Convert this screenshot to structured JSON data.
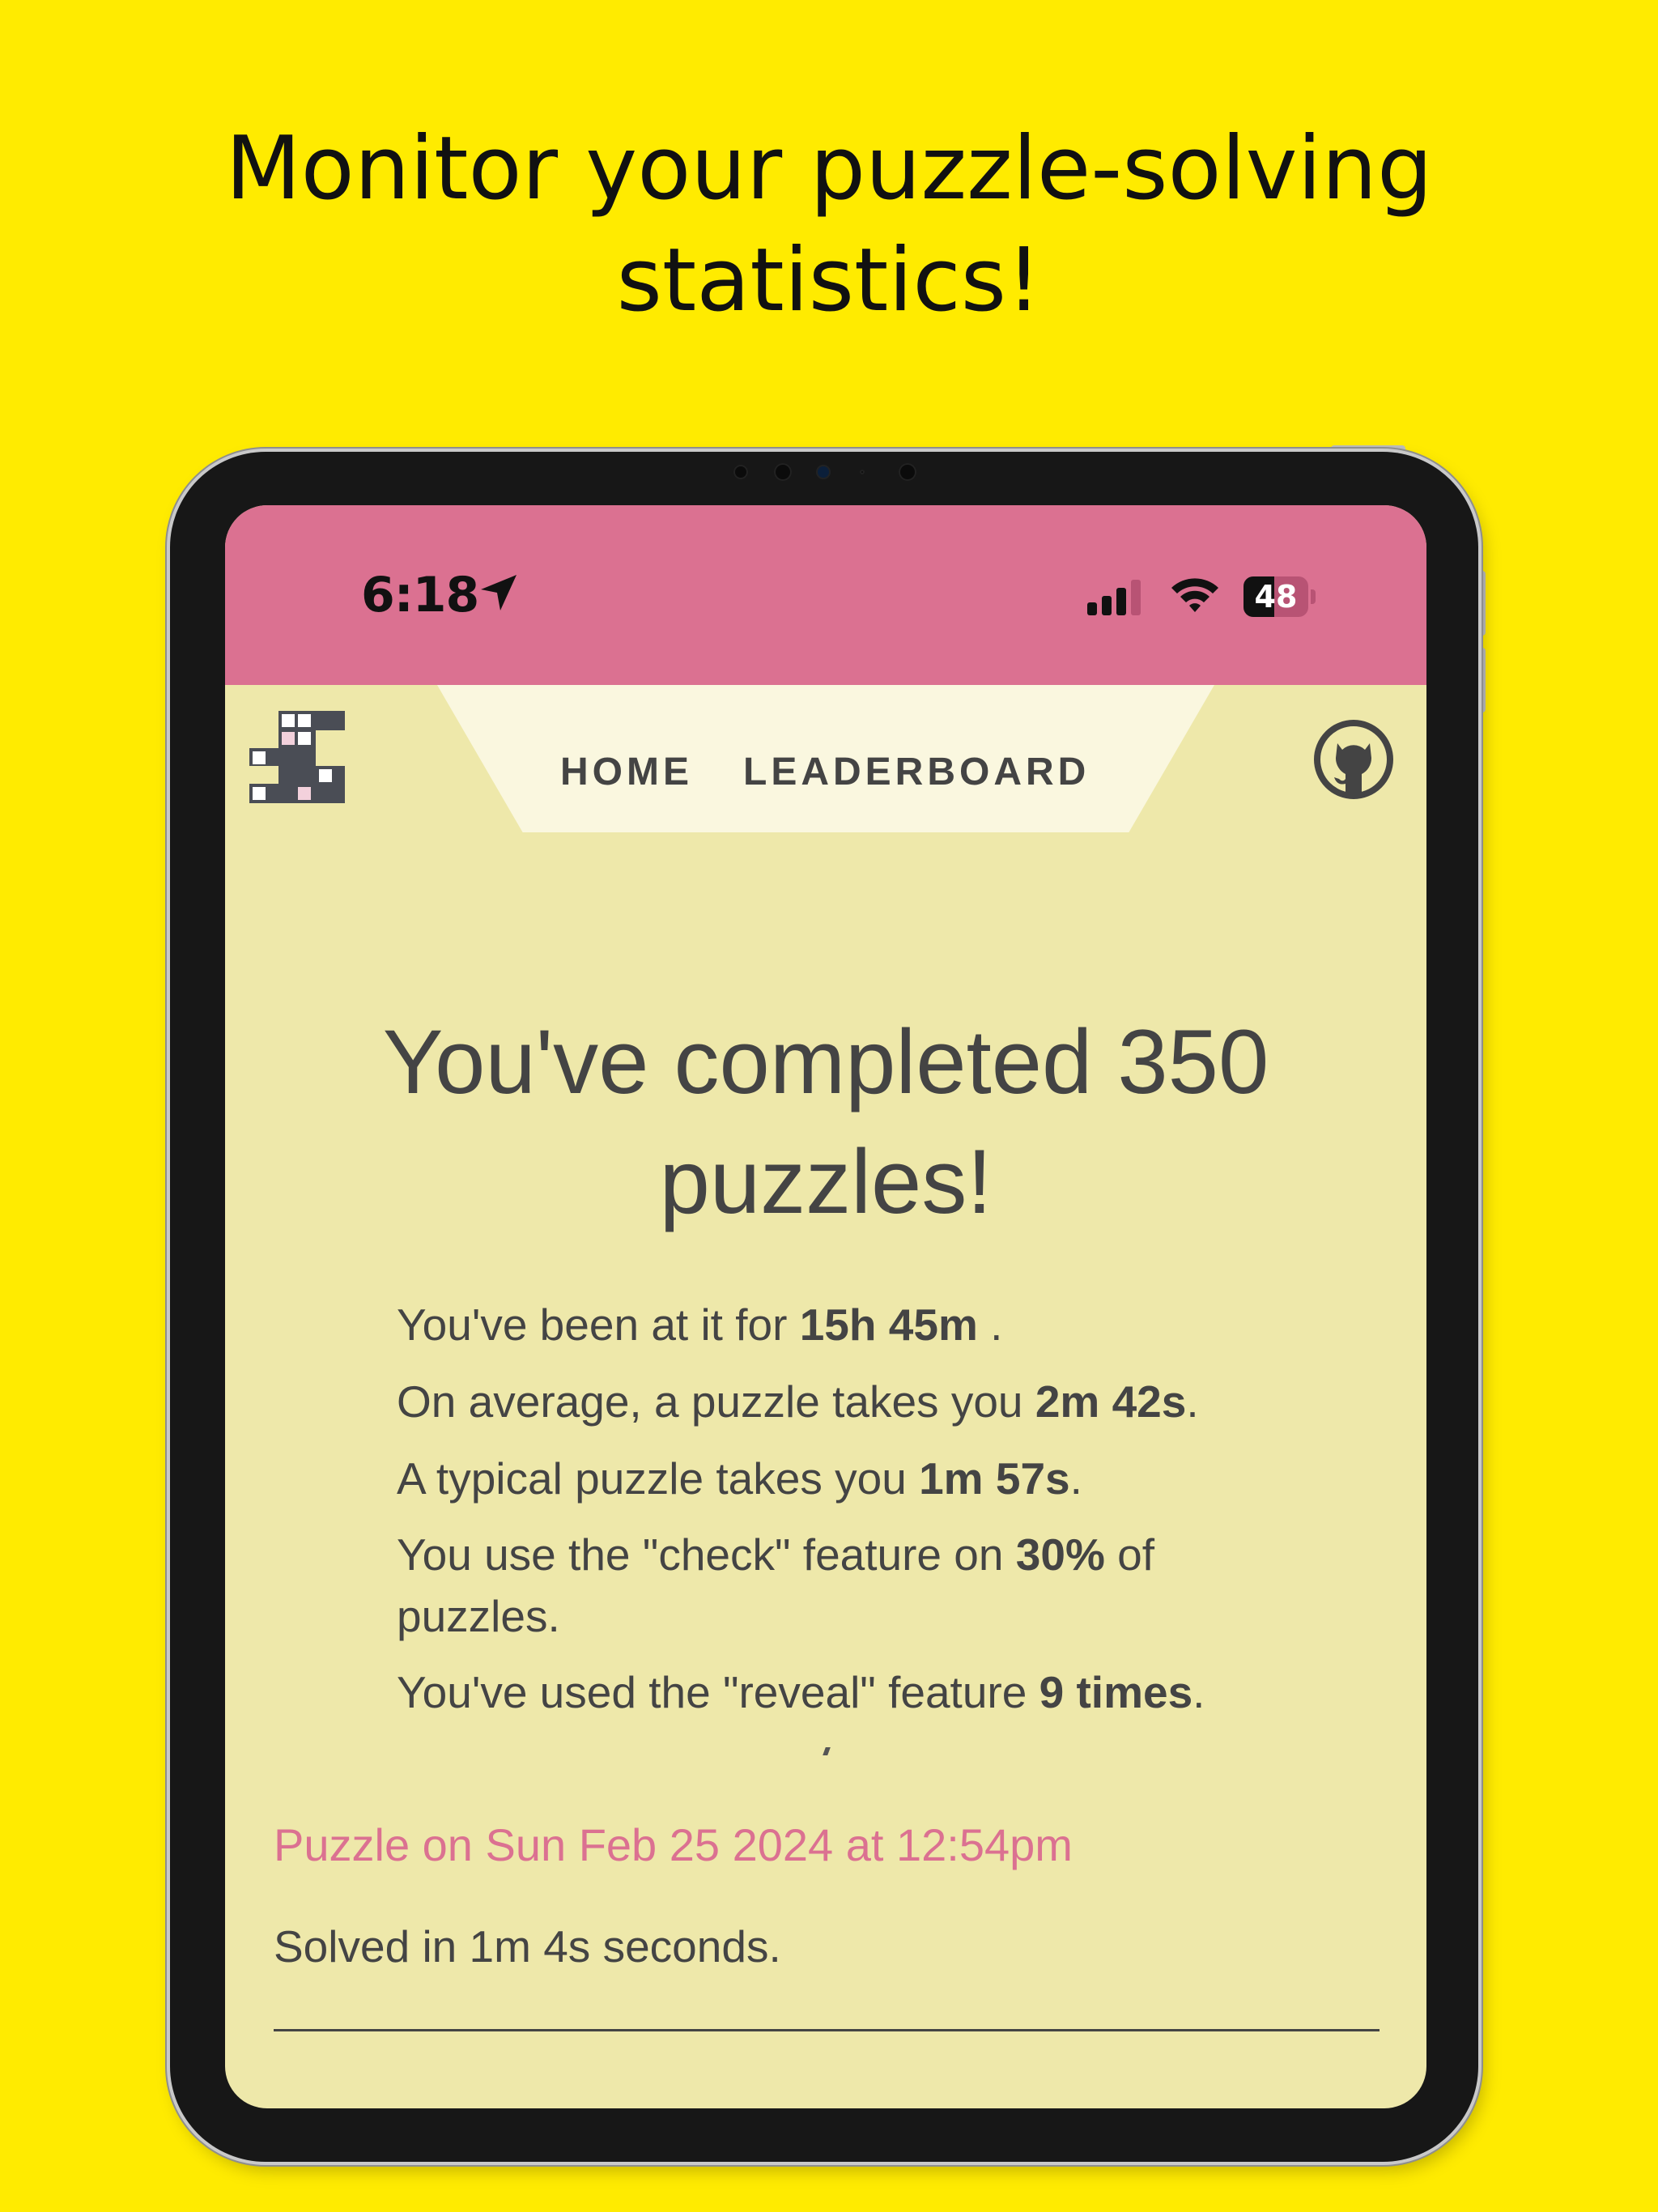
{
  "headline": {
    "line1": "Monitor your puzzle-solving",
    "line2": "statistics!"
  },
  "status_bar": {
    "time": "6:18",
    "battery": "48",
    "battery_level": 0.48,
    "icons": [
      "location-arrow-icon",
      "signal-icon",
      "wifi-icon",
      "battery-icon"
    ]
  },
  "nav": {
    "home": "HOME",
    "leaderboard": "LEADERBOARD",
    "icons": [
      "crossword-logo-icon",
      "github-icon"
    ]
  },
  "main": {
    "completed_line1": "You've completed 350",
    "completed_line2": "puzzles!",
    "stats": [
      {
        "before": "You've been at it for ",
        "value": "15h 45m",
        "after": " ."
      },
      {
        "before": "On average, a puzzle takes you ",
        "value": "2m 42s",
        "after": "."
      },
      {
        "before": "A typical puzzle takes you ",
        "value": "1m 57s",
        "after": "."
      },
      {
        "before": "You use the \"check\" feature on ",
        "value": "30%",
        "after": " of"
      },
      {
        "before": "puzzles.",
        "value": "",
        "after": ""
      },
      {
        "before": "You've used the \"reveal\" feature ",
        "value": "9 times",
        "after": "."
      }
    ]
  },
  "puzzle_entry": {
    "title": "Puzzle on Sun Feb 25 2024 at 12:54pm",
    "solved": "Solved in 1m 4s seconds."
  },
  "colors": {
    "page_background": "#ffeb00",
    "status_bar": "#db7191",
    "app_background": "#eee8aa",
    "nav_tab": "#faf7df",
    "accent_pink": "#db7191",
    "text": "#444444"
  }
}
